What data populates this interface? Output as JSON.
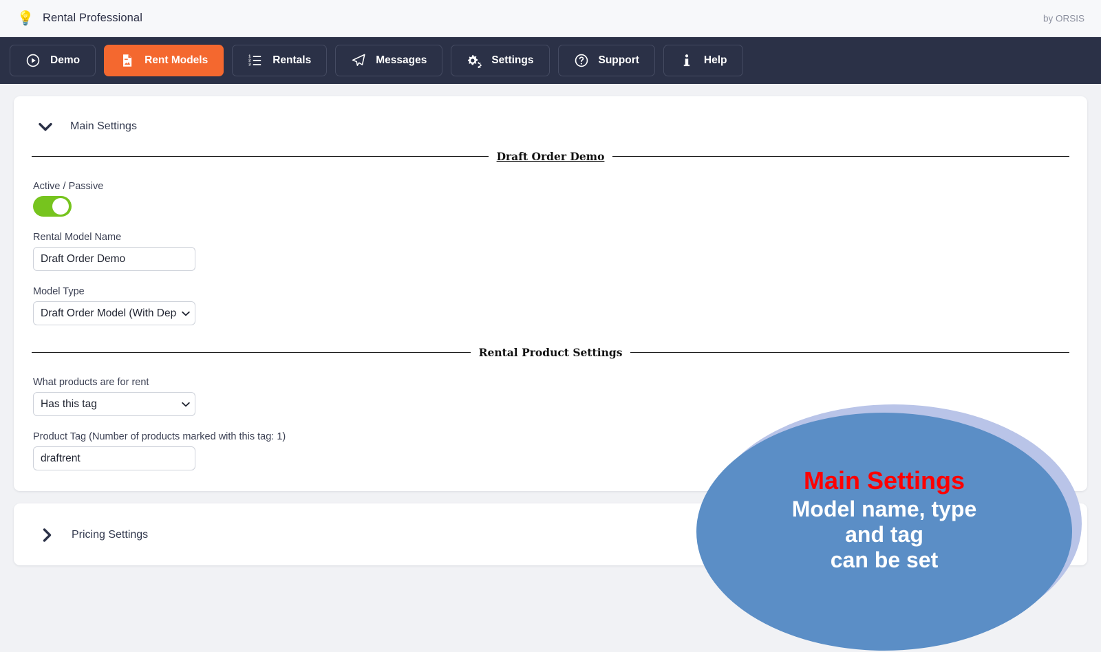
{
  "header": {
    "logo_icon": "lightbulb-icon",
    "brand": "Rental Professional",
    "byline": "by ORSIS"
  },
  "nav": {
    "items": [
      {
        "label": "Demo",
        "icon": "play-circle-icon",
        "active": false
      },
      {
        "label": "Rent Models",
        "icon": "file-document-icon",
        "active": true
      },
      {
        "label": "Rentals",
        "icon": "ordered-list-icon",
        "active": false
      },
      {
        "label": "Messages",
        "icon": "paper-plane-icon",
        "active": false
      },
      {
        "label": "Settings",
        "icon": "gears-icon",
        "active": false
      },
      {
        "label": "Support",
        "icon": "question-circle-icon",
        "active": false
      },
      {
        "label": "Help",
        "icon": "info-icon",
        "active": false
      }
    ],
    "active_color": "#f4682f",
    "background_color": "#2b3147"
  },
  "main_settings": {
    "section_title": "Main Settings",
    "section_chevron": "chevron-down-icon",
    "legend": "Draft Order Demo",
    "active_passive": {
      "label": "Active / Passive",
      "state": "on",
      "on_color": "#76c41e"
    },
    "model_name": {
      "label": "Rental Model Name",
      "value": "Draft Order Demo"
    },
    "model_type": {
      "label": "Model Type",
      "value": "Draft Order Model (With Deposit)"
    }
  },
  "rental_product_settings": {
    "legend": "Rental Product Settings",
    "what_products": {
      "label": "What products are for rent",
      "value": "Has this tag"
    },
    "product_tag": {
      "label": "Product Tag (Number of products marked with this tag: 1)",
      "value": "draftrent"
    }
  },
  "pricing_settings": {
    "section_title": "Pricing Settings",
    "section_chevron": "chevron-right-icon"
  },
  "callout": {
    "title": "Main Settings",
    "lines": [
      "Model name, type",
      "and tag",
      "can be set"
    ],
    "fill_color": "#5b8ec6",
    "shadow_color": "#b9c4e8",
    "title_color": "#ff0000",
    "text_color": "#ffffff"
  }
}
